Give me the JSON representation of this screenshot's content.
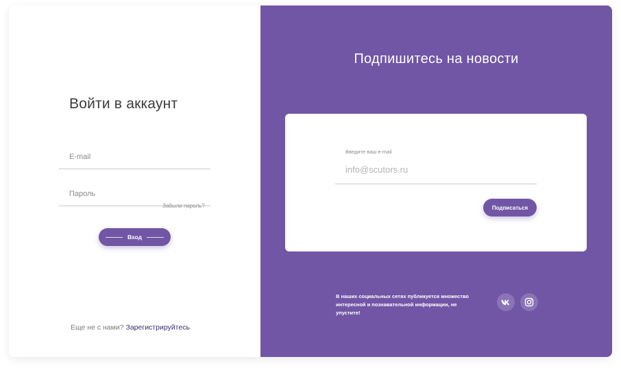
{
  "login": {
    "title": "Войти в аккаунт",
    "email_placeholder": "E-mail",
    "password_placeholder": "Пароль",
    "forgot_link": "Забыли пароль?",
    "login_button": "Вход",
    "register_prompt": "Еще не с нами?",
    "register_link": "Зарегистрируйтесь"
  },
  "subscribe": {
    "title": "Подпишитесь на новости",
    "email_label": "Введите ваш e-mail",
    "email_placeholder": "info@scutors.ru",
    "button": "Подписаться",
    "social_text": "В наших социальных сетях публикуется множество интересной и познавательной информации, не упустите!",
    "social_icons": [
      "vk-icon",
      "instagram-icon"
    ]
  },
  "colors": {
    "brand": "#7156a5",
    "link": "#3b2a74"
  }
}
